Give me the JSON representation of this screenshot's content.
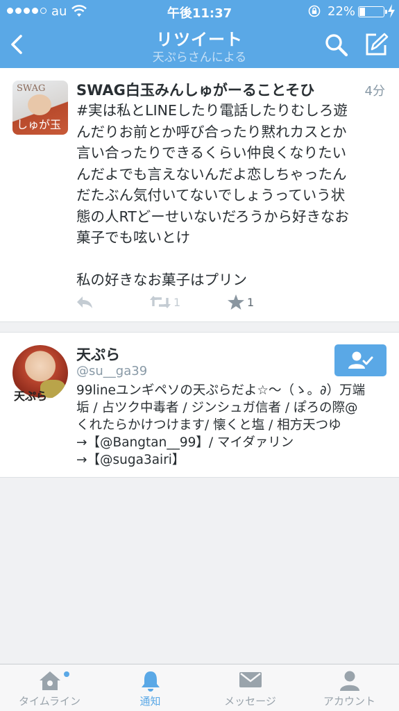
{
  "status_bar": {
    "carrier": "au",
    "time": "午後11:37",
    "battery": "22%",
    "battery_level": 0.22
  },
  "nav": {
    "title": "リツイート",
    "subtitle": "天ぷらさんによる"
  },
  "tweet": {
    "author": "SWAG白玉みんしゅがーることそひ",
    "time": "4分",
    "avatar_text_top": "SWAG",
    "avatar_text_bottom": "しゅが玉",
    "text": "#実は私とLINEしたり電話したりむしろ遊\nんだりお前とか呼び合ったり黙れカスとか\n言い合ったりできるくらい仲良くなりたい\nんだよでも言えないんだよ恋しちゃったん\nだたぶん気付いてないでしょうっていう状\n態の人RTどーせいないだろうから好きなお\n菓子でも呟いとけ\n\n私の好きなお菓子はプリン",
    "retweet_count": "1",
    "favorite_count": "1"
  },
  "user": {
    "name": "天ぷら",
    "handle": "@su__ga39",
    "avatar_label": "天ぷら",
    "bio": "99lineユンギペソの天ぷらだよ☆〜（ゝ。∂）万端\n垢 / 占ツク中毒者 / ジンシュガ信者 / ぽろの際@\nくれたらかけつけます/ 懐くと塩 / 相方天つゆ\n→【@Bangtan__99】/ マイダァリン\n→【@suga3airi】"
  },
  "tabs": [
    {
      "label": "タイムライン",
      "icon": "home-icon",
      "active": false
    },
    {
      "label": "通知",
      "icon": "bell-icon",
      "active": true
    },
    {
      "label": "メッセージ",
      "icon": "envelope-icon",
      "active": false
    },
    {
      "label": "アカウント",
      "icon": "person-icon",
      "active": false
    }
  ],
  "colors": {
    "brand": "#5aa8e6",
    "text": "#292f33",
    "muted": "#8899a6"
  }
}
